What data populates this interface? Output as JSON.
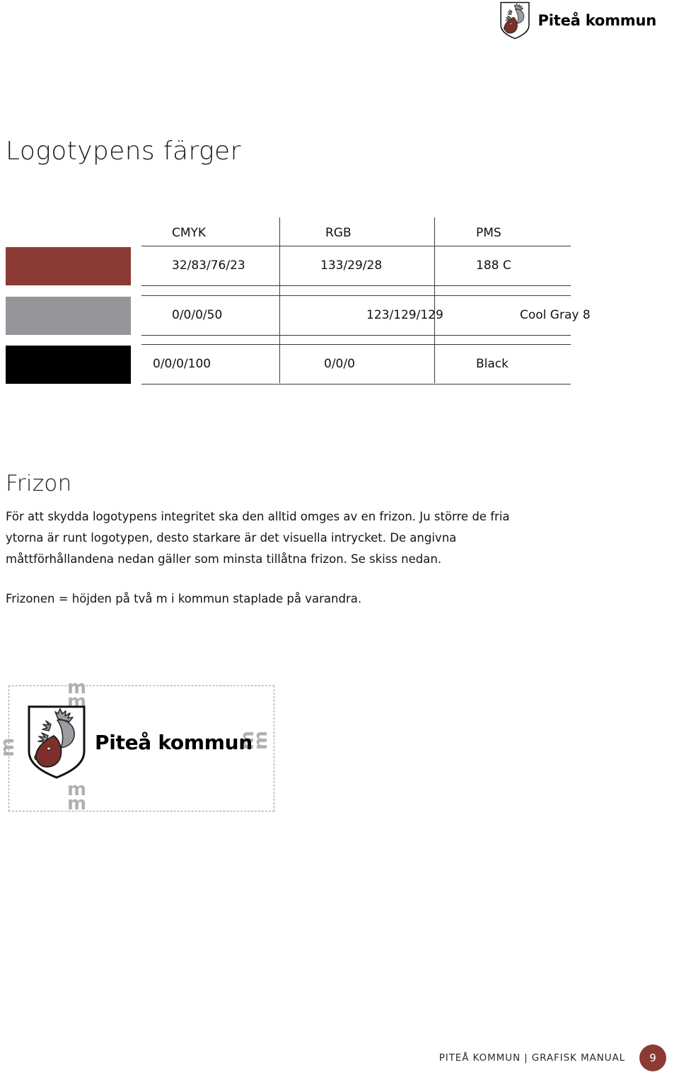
{
  "header": {
    "logo_icon": "pitea-coat-of-arms-shield-icon",
    "wordmark": "Piteå kommun"
  },
  "page_title": "Logotypens färger",
  "color_table": {
    "columns": [
      "CMYK",
      "RGB",
      "PMS"
    ],
    "rows": [
      {
        "swatch_name": "red-swatch",
        "swatch_color": "#8c3a34",
        "cmyk": "32/83/76/23",
        "rgb": "133/29/28",
        "pms": "188 C"
      },
      {
        "swatch_name": "gray-swatch",
        "swatch_color": "#949699",
        "cmyk": "0/0/0/50",
        "rgb": "123/129/129",
        "pms": "Cool Gray 8"
      },
      {
        "swatch_name": "black-swatch",
        "swatch_color": "#000000",
        "cmyk": "0/0/0/100",
        "rgb": "0/0/0",
        "pms": "Black"
      }
    ]
  },
  "frizon": {
    "heading": "Frizon",
    "paragraph_1": "För att skydda logotypens integritet ska den alltid omges av en frizon. Ju större de fria ytorna är runt logotypen, desto starkare är det visuella intrycket. De angivna måttförhållandena nedan gäller som minsta tillåtna frizon. Se skiss nedan.",
    "paragraph_2": "Frizonen = höjden på två m i kommun staplade på varandra.",
    "diagram": {
      "logo_icon": "pitea-coat-of-arms-shield-icon",
      "wordmark": "Piteå kommun",
      "marker_top": "m\nm",
      "marker_bottom": "m\nm",
      "marker_left": "m\nm",
      "marker_right": "m\nm"
    }
  },
  "footer": {
    "text": "PITEÅ KOMMUN | GRAFISK MANUAL",
    "page_number": "9",
    "badge_color": "#8c3a34"
  }
}
